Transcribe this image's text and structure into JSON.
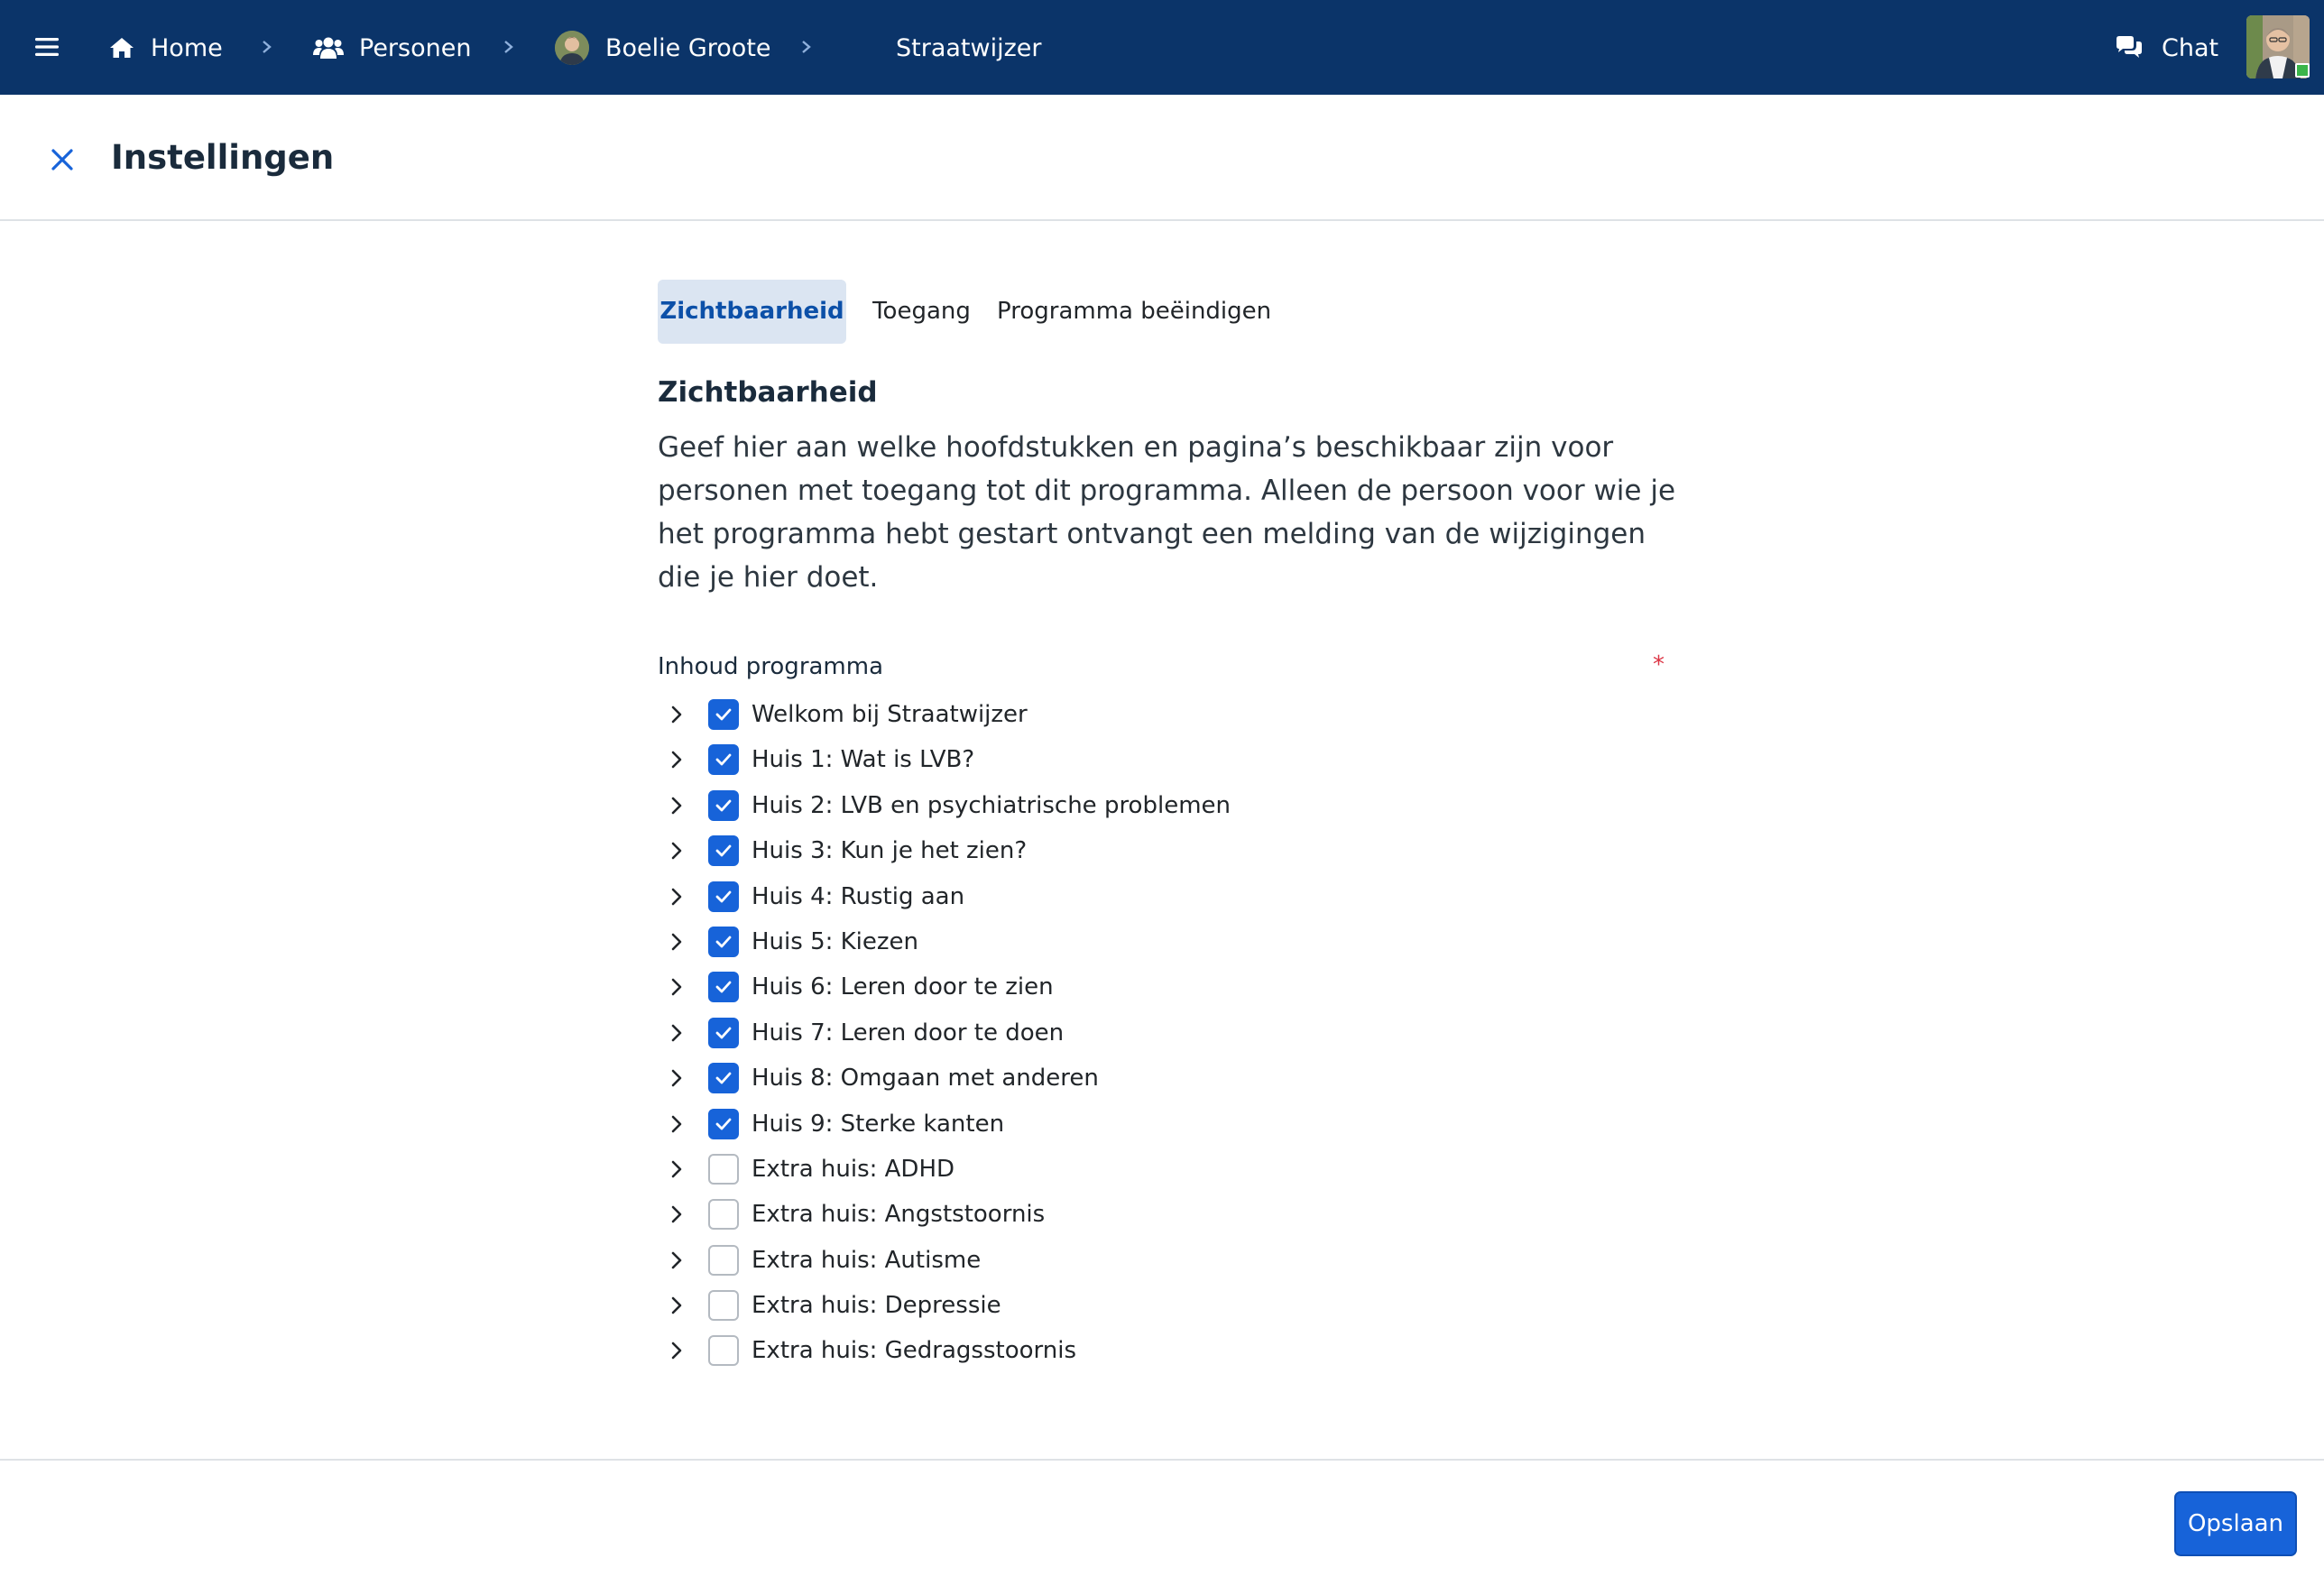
{
  "nav": {
    "menu_icon": "hamburger-icon",
    "breadcrumbs": [
      {
        "label": "Home",
        "icon": "home-icon"
      },
      {
        "label": "Personen",
        "icon": "users-icon"
      },
      {
        "label": "Boelie Groote",
        "icon": "avatar"
      },
      {
        "label": "Straatwijzer"
      }
    ],
    "chat": {
      "label": "Chat",
      "icon": "chat-icon"
    },
    "user_status": "online"
  },
  "header": {
    "title": "Instellingen",
    "close_icon": "close-icon"
  },
  "tabs": [
    {
      "label": "Zichtbaarheid",
      "active": true
    },
    {
      "label": "Toegang",
      "active": false
    },
    {
      "label": "Programma beëindigen",
      "active": false
    }
  ],
  "section": {
    "title": "Zichtbaarheid",
    "description": "Geef hier aan welke hoofdstukken en pagina’s beschikbaar zijn voor personen met toegang tot dit programma. Alleen de persoon voor wie je het programma hebt gestart ontvangt een melding van de wijzigingen die je hier doet."
  },
  "content": {
    "label": "Inhoud programma",
    "required_marker": "*",
    "items": [
      {
        "label": "Welkom bij Straatwijzer",
        "checked": true
      },
      {
        "label": "Huis 1: Wat is LVB?",
        "checked": true
      },
      {
        "label": "Huis 2: LVB en psychiatrische problemen",
        "checked": true
      },
      {
        "label": "Huis 3: Kun je het zien?",
        "checked": true
      },
      {
        "label": "Huis 4: Rustig aan",
        "checked": true
      },
      {
        "label": "Huis 5: Kiezen",
        "checked": true
      },
      {
        "label": "Huis 6: Leren door te zien",
        "checked": true
      },
      {
        "label": "Huis 7: Leren door te doen",
        "checked": true
      },
      {
        "label": "Huis 8: Omgaan met anderen",
        "checked": true
      },
      {
        "label": "Huis 9: Sterke kanten",
        "checked": true
      },
      {
        "label": "Extra huis: ADHD",
        "checked": false
      },
      {
        "label": "Extra huis: Angststoornis",
        "checked": false
      },
      {
        "label": "Extra huis: Autisme",
        "checked": false
      },
      {
        "label": "Extra huis: Depressie",
        "checked": false
      },
      {
        "label": "Extra huis: Gedragsstoornis",
        "checked": false
      }
    ]
  },
  "footer": {
    "save_label": "Opslaan"
  },
  "colors": {
    "navbar": "#0b3469",
    "primary": "#1763d9",
    "active_tab_bg": "#dbe5f2",
    "active_tab_text": "#0c50a8",
    "required": "#dc3545",
    "online": "#3bb54a"
  }
}
